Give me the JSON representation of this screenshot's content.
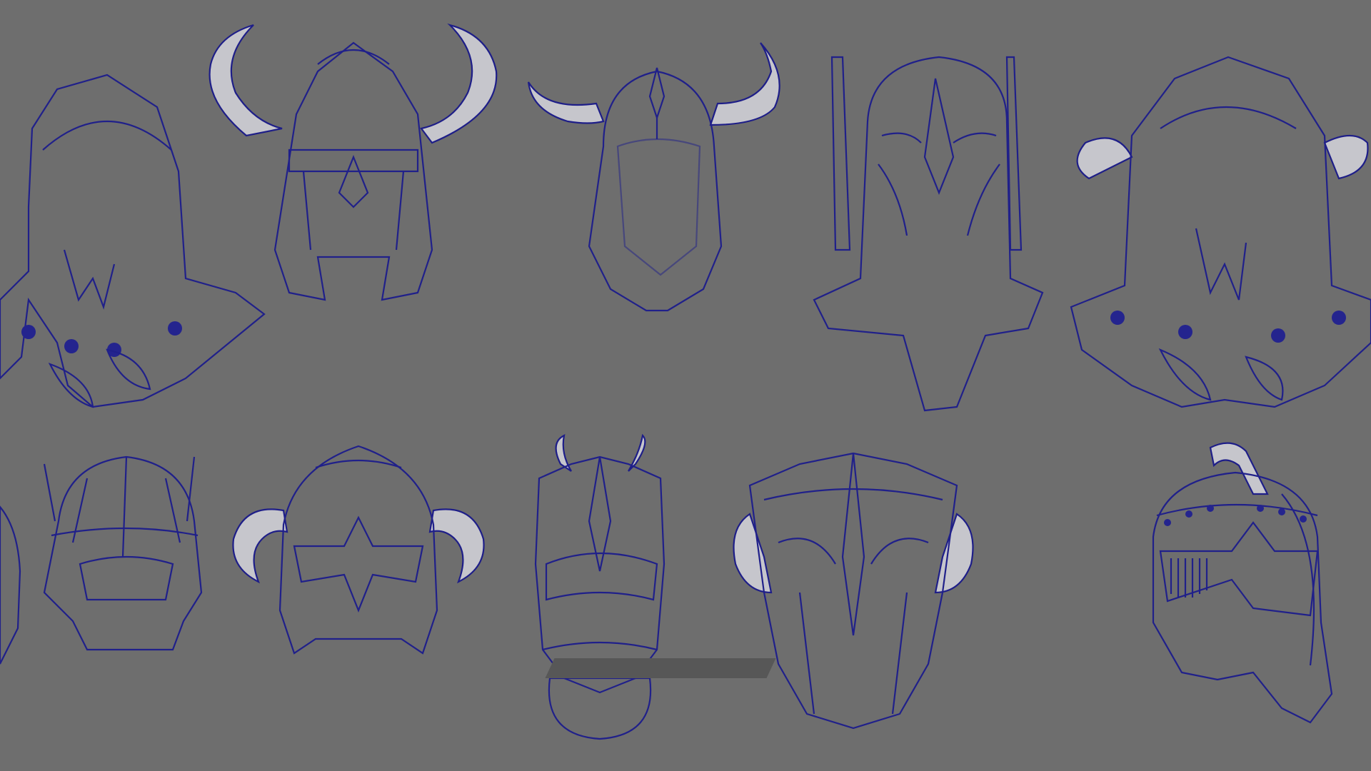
{
  "viewport": {
    "background": "#6e6e6e",
    "wireframe_color": "#20208a",
    "shaded_color": "#c9c9cf"
  },
  "models": [
    {
      "name": "spiked-helmet-with-pauldrons",
      "row": 1
    },
    {
      "name": "horned-helmet-with-face-guard",
      "row": 1
    },
    {
      "name": "horned-nasal-helmet",
      "row": 1
    },
    {
      "name": "crested-long-face-helmet",
      "row": 1
    },
    {
      "name": "spiked-horned-helmet-with-pauldrons",
      "row": 1
    },
    {
      "name": "partial-helmet-edge",
      "row": 2
    },
    {
      "name": "ribbed-dome-helmet",
      "row": 2
    },
    {
      "name": "horned-masked-helmet",
      "row": 2
    },
    {
      "name": "antlered-visor-helmet",
      "row": 2
    },
    {
      "name": "winged-mask-helmet",
      "row": 2
    },
    {
      "name": "studded-barbute-helmet",
      "row": 2
    }
  ]
}
